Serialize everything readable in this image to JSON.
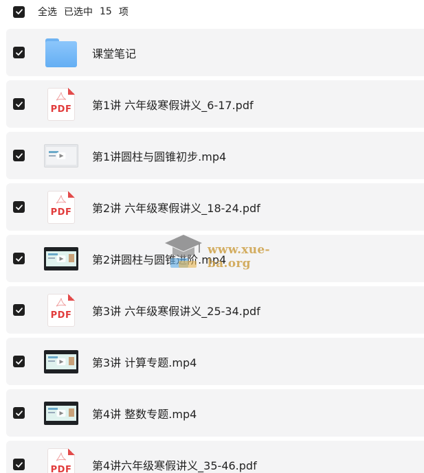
{
  "select_all": {
    "label": "全选",
    "selected_prefix": "已选中",
    "count": "15",
    "suffix": "项",
    "checked": true
  },
  "files": [
    {
      "name": "课堂笔记",
      "type": "folder",
      "checked": true
    },
    {
      "name": "第1讲 六年级寒假讲义_6-17.pdf",
      "type": "pdf",
      "checked": true
    },
    {
      "name": "第1讲圆柱与圆锥初步.mp4",
      "type": "video-light",
      "checked": true
    },
    {
      "name": "第2讲 六年级寒假讲义_18-24.pdf",
      "type": "pdf",
      "checked": true
    },
    {
      "name": "第2讲圆柱与圆锥进阶.mp4",
      "type": "video",
      "checked": true
    },
    {
      "name": "第3讲 六年级寒假讲义_25-34.pdf",
      "type": "pdf",
      "checked": true
    },
    {
      "name": "第3讲 计算专题.mp4",
      "type": "video",
      "checked": true
    },
    {
      "name": "第4讲 整数专题.mp4",
      "type": "video",
      "checked": true
    },
    {
      "name": "第4讲六年级寒假讲义_35-46.pdf",
      "type": "pdf",
      "checked": true
    }
  ],
  "icons": {
    "checkbox": "checkmark-icon",
    "folder": "folder-icon",
    "pdf": "pdf-file-icon",
    "video": "video-thumbnail-icon"
  },
  "pdf_icon_label": "PDF",
  "watermark": {
    "text": "www.xue-ba.org"
  },
  "colors": {
    "checkbox": "#1f1f1f",
    "row_background": "#f4f4f5",
    "pdf_red": "#e13b3b",
    "folder_blue": "#64aef3"
  }
}
